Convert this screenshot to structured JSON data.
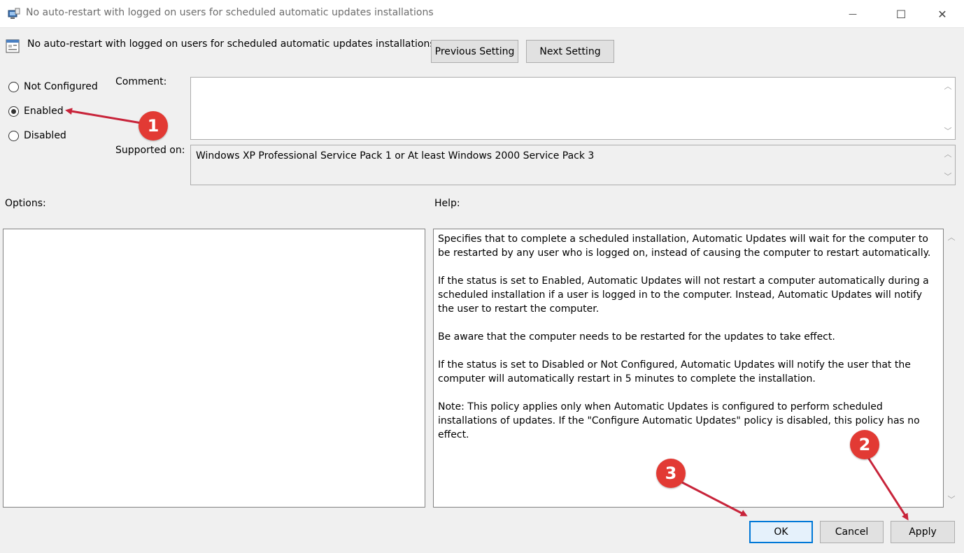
{
  "window": {
    "title": "No auto-restart with logged on users for scheduled automatic updates installations",
    "minimize_glyph": "—",
    "maximize_glyph": "☐",
    "close_glyph": "✕"
  },
  "header": {
    "policy_title": "No auto-restart with logged on users for scheduled automatic updates installations",
    "previous_label": "Previous Setting",
    "next_label": "Next Setting"
  },
  "state": {
    "options": [
      {
        "label": "Not Configured",
        "selected": false
      },
      {
        "label": "Enabled",
        "selected": true
      },
      {
        "label": "Disabled",
        "selected": false
      }
    ]
  },
  "comment": {
    "label": "Comment:",
    "value": ""
  },
  "supported": {
    "label": "Supported on:",
    "value": "Windows XP Professional Service Pack 1 or At least Windows 2000 Service Pack 3"
  },
  "options_panel": {
    "label": "Options:"
  },
  "help_panel": {
    "label": "Help:",
    "paragraphs": [
      "Specifies that to complete a scheduled installation, Automatic Updates will wait for the computer to be restarted by any user who is logged on, instead of causing the computer to restart automatically.",
      "If the status is set to Enabled, Automatic Updates will not restart a computer automatically during a scheduled installation if a user is logged in to the computer. Instead, Automatic Updates will notify the user to restart the computer.",
      "Be aware that the computer needs to be restarted for the updates to take effect.",
      "If the status is set to Disabled or Not Configured, Automatic Updates will notify the user that the computer will automatically restart in 5 minutes to complete the installation.",
      "Note: This policy applies only when Automatic Updates is configured to perform scheduled installations of updates. If the \"Configure Automatic Updates\" policy is disabled, this policy has no effect."
    ]
  },
  "footer": {
    "ok_label": "OK",
    "cancel_label": "Cancel",
    "apply_label": "Apply"
  },
  "annotations": {
    "badge_color": "#e23a34",
    "badges": [
      "1",
      "2",
      "3"
    ]
  },
  "colors": {
    "accent": "#0078d7",
    "background": "#f0f0f0"
  }
}
